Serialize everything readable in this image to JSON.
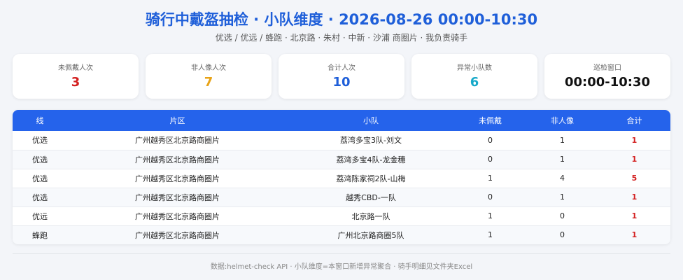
{
  "header": {
    "title": "骑行中戴盔抽检 · 小队维度 · 2026-08-26 00:00-10:30",
    "subtitle": "优选 / 优远 / 蜂跑 · 北京路 · 朱村 · 中新 · 沙浦 商圈片 · 我负责骑手"
  },
  "cards": [
    {
      "label": "未佩戴人次",
      "value": "3",
      "color": "#d32020"
    },
    {
      "label": "非人像人次",
      "value": "7",
      "color": "#e8a317"
    },
    {
      "label": "合计人次",
      "value": "10",
      "color": "#1f5fd9"
    },
    {
      "label": "异常小队数",
      "value": "6",
      "color": "#16a9c9"
    },
    {
      "label": "巡检窗口",
      "value": "00:00-10:30",
      "color": "#111111"
    }
  ],
  "table": {
    "headers": [
      "线",
      "片区",
      "小队",
      "未佩戴",
      "非人像",
      "合计"
    ],
    "rows": [
      [
        "优选",
        "广州越秀区北京路商圈片",
        "荔湾多宝3队-刘文",
        "0",
        "1",
        "1"
      ],
      [
        "优选",
        "广州越秀区北京路商圈片",
        "荔湾多宝4队-龙金穗",
        "0",
        "1",
        "1"
      ],
      [
        "优选",
        "广州越秀区北京路商圈片",
        "荔湾陈家祠2队-山梅",
        "1",
        "4",
        "5"
      ],
      [
        "优选",
        "广州越秀区北京路商圈片",
        "越秀CBD-一队",
        "0",
        "1",
        "1"
      ],
      [
        "优远",
        "广州越秀区北京路商圈片",
        "北京路一队",
        "1",
        "0",
        "1"
      ],
      [
        "蜂跑",
        "广州越秀区北京路商圈片",
        "广州北京路商圈5队",
        "1",
        "0",
        "1"
      ]
    ]
  },
  "footer": {
    "text": "数据:helmet-check API · 小队维度=本窗口新增异常聚合 · 骑手明细见文件夹Excel"
  }
}
